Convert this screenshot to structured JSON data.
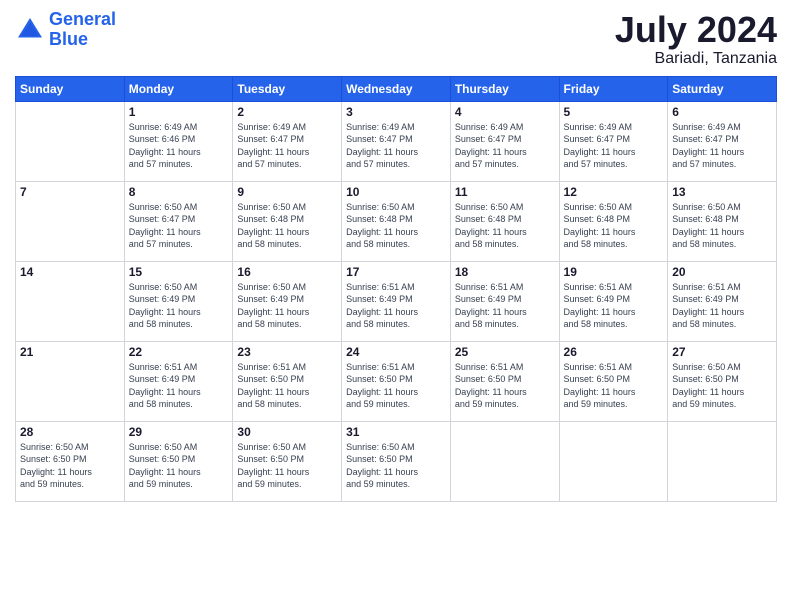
{
  "header": {
    "logo_line1": "General",
    "logo_line2": "Blue",
    "month_year": "July 2024",
    "location": "Bariadi, Tanzania"
  },
  "days_of_week": [
    "Sunday",
    "Monday",
    "Tuesday",
    "Wednesday",
    "Thursday",
    "Friday",
    "Saturday"
  ],
  "weeks": [
    [
      {
        "day": "",
        "info": ""
      },
      {
        "day": "1",
        "info": "Sunrise: 6:49 AM\nSunset: 6:46 PM\nDaylight: 11 hours\nand 57 minutes."
      },
      {
        "day": "2",
        "info": "Sunrise: 6:49 AM\nSunset: 6:47 PM\nDaylight: 11 hours\nand 57 minutes."
      },
      {
        "day": "3",
        "info": "Sunrise: 6:49 AM\nSunset: 6:47 PM\nDaylight: 11 hours\nand 57 minutes."
      },
      {
        "day": "4",
        "info": "Sunrise: 6:49 AM\nSunset: 6:47 PM\nDaylight: 11 hours\nand 57 minutes."
      },
      {
        "day": "5",
        "info": "Sunrise: 6:49 AM\nSunset: 6:47 PM\nDaylight: 11 hours\nand 57 minutes."
      },
      {
        "day": "6",
        "info": "Sunrise: 6:49 AM\nSunset: 6:47 PM\nDaylight: 11 hours\nand 57 minutes."
      }
    ],
    [
      {
        "day": "7",
        "info": ""
      },
      {
        "day": "8",
        "info": "Sunrise: 6:50 AM\nSunset: 6:47 PM\nDaylight: 11 hours\nand 57 minutes."
      },
      {
        "day": "9",
        "info": "Sunrise: 6:50 AM\nSunset: 6:48 PM\nDaylight: 11 hours\nand 58 minutes."
      },
      {
        "day": "10",
        "info": "Sunrise: 6:50 AM\nSunset: 6:48 PM\nDaylight: 11 hours\nand 58 minutes."
      },
      {
        "day": "11",
        "info": "Sunrise: 6:50 AM\nSunset: 6:48 PM\nDaylight: 11 hours\nand 58 minutes."
      },
      {
        "day": "12",
        "info": "Sunrise: 6:50 AM\nSunset: 6:48 PM\nDaylight: 11 hours\nand 58 minutes."
      },
      {
        "day": "13",
        "info": "Sunrise: 6:50 AM\nSunset: 6:48 PM\nDaylight: 11 hours\nand 58 minutes."
      }
    ],
    [
      {
        "day": "14",
        "info": ""
      },
      {
        "day": "15",
        "info": "Sunrise: 6:50 AM\nSunset: 6:49 PM\nDaylight: 11 hours\nand 58 minutes."
      },
      {
        "day": "16",
        "info": "Sunrise: 6:50 AM\nSunset: 6:49 PM\nDaylight: 11 hours\nand 58 minutes."
      },
      {
        "day": "17",
        "info": "Sunrise: 6:51 AM\nSunset: 6:49 PM\nDaylight: 11 hours\nand 58 minutes."
      },
      {
        "day": "18",
        "info": "Sunrise: 6:51 AM\nSunset: 6:49 PM\nDaylight: 11 hours\nand 58 minutes."
      },
      {
        "day": "19",
        "info": "Sunrise: 6:51 AM\nSunset: 6:49 PM\nDaylight: 11 hours\nand 58 minutes."
      },
      {
        "day": "20",
        "info": "Sunrise: 6:51 AM\nSunset: 6:49 PM\nDaylight: 11 hours\nand 58 minutes."
      }
    ],
    [
      {
        "day": "21",
        "info": ""
      },
      {
        "day": "22",
        "info": "Sunrise: 6:51 AM\nSunset: 6:49 PM\nDaylight: 11 hours\nand 58 minutes."
      },
      {
        "day": "23",
        "info": "Sunrise: 6:51 AM\nSunset: 6:50 PM\nDaylight: 11 hours\nand 58 minutes."
      },
      {
        "day": "24",
        "info": "Sunrise: 6:51 AM\nSunset: 6:50 PM\nDaylight: 11 hours\nand 59 minutes."
      },
      {
        "day": "25",
        "info": "Sunrise: 6:51 AM\nSunset: 6:50 PM\nDaylight: 11 hours\nand 59 minutes."
      },
      {
        "day": "26",
        "info": "Sunrise: 6:51 AM\nSunset: 6:50 PM\nDaylight: 11 hours\nand 59 minutes."
      },
      {
        "day": "27",
        "info": "Sunrise: 6:50 AM\nSunset: 6:50 PM\nDaylight: 11 hours\nand 59 minutes."
      }
    ],
    [
      {
        "day": "28",
        "info": "Sunrise: 6:50 AM\nSunset: 6:50 PM\nDaylight: 11 hours\nand 59 minutes."
      },
      {
        "day": "29",
        "info": "Sunrise: 6:50 AM\nSunset: 6:50 PM\nDaylight: 11 hours\nand 59 minutes."
      },
      {
        "day": "30",
        "info": "Sunrise: 6:50 AM\nSunset: 6:50 PM\nDaylight: 11 hours\nand 59 minutes."
      },
      {
        "day": "31",
        "info": "Sunrise: 6:50 AM\nSunset: 6:50 PM\nDaylight: 11 hours\nand 59 minutes."
      },
      {
        "day": "",
        "info": ""
      },
      {
        "day": "",
        "info": ""
      },
      {
        "day": "",
        "info": ""
      }
    ]
  ]
}
